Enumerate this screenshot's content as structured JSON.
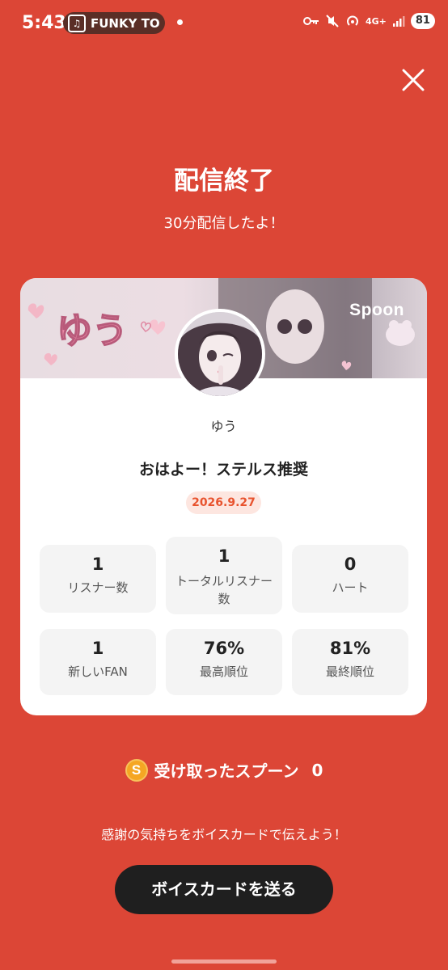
{
  "status_bar": {
    "time": "5:43",
    "music_chip_text": "FUNKY TO",
    "network_label": "4G+",
    "battery": "81"
  },
  "header": {
    "title": "配信終了",
    "subtitle": "30分配信したよ！"
  },
  "card": {
    "banner_logo": "Spoon",
    "banner_name_art": "ゆう",
    "dj_name": "ゆう",
    "live_title": "おはよー！ステルス推奨",
    "date": "2026.9.27",
    "stats": [
      {
        "value": "1",
        "label": "リスナー数"
      },
      {
        "value": "1",
        "label": "トータルリスナー数"
      },
      {
        "value": "0",
        "label": "ハート"
      },
      {
        "value": "1",
        "label": "新しいFAN"
      },
      {
        "value": "76%",
        "label": "最高順位"
      },
      {
        "value": "81%",
        "label": "最終順位"
      }
    ]
  },
  "spoons": {
    "coin_symbol": "S",
    "label": "受け取ったスプーン",
    "count": "0"
  },
  "footer": {
    "thanks_text": "感謝の気持ちをボイスカードで伝えよう！",
    "button_label": "ボイスカードを送る"
  },
  "colors": {
    "background": "#dc4636",
    "button": "#1f1f1f",
    "date_text": "#e8532e",
    "coin": "#f5a623"
  }
}
